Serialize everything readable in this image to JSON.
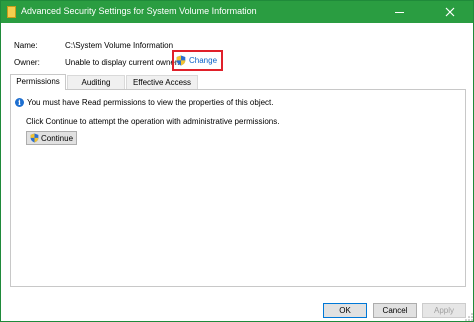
{
  "window": {
    "title": "Advanced Security Settings for System Volume Information",
    "accent_color": "#2a9d41"
  },
  "name_row": {
    "label": "Name:",
    "value": "C:\\System Volume Information"
  },
  "owner_row": {
    "label": "Owner:",
    "value": "Unable to display current owner.",
    "change_link": "Change"
  },
  "tabs": [
    {
      "label": "Permissions",
      "selected": true
    },
    {
      "label": "Auditing",
      "selected": false
    },
    {
      "label": "Effective Access",
      "selected": false
    }
  ],
  "message": {
    "icon": "info-icon",
    "text": "You must have Read permissions to view the properties of this object.",
    "instruction": "Click Continue to attempt the operation with administrative permissions.",
    "continue_label": "Continue"
  },
  "footer": {
    "ok_label": "OK",
    "cancel_label": "Cancel",
    "apply_label": "Apply"
  },
  "colors": {
    "highlight_border": "#e0202a",
    "link": "#0a61c8",
    "info_icon": "#1e6fd0"
  }
}
